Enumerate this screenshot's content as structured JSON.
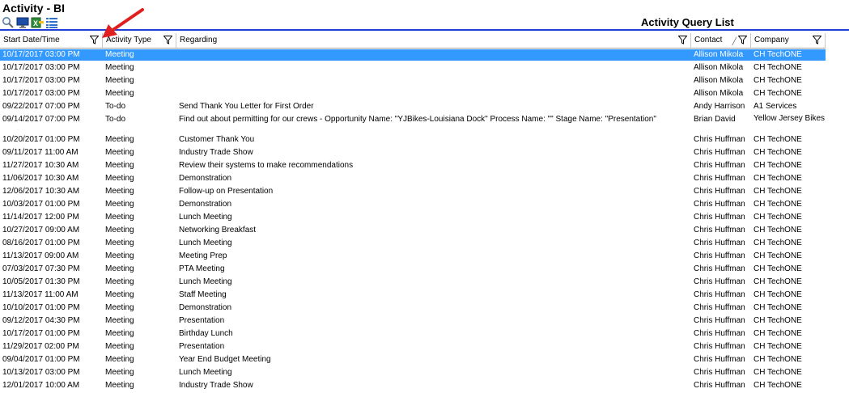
{
  "app": {
    "title": "Activity - BI"
  },
  "toolbar": {
    "icons": [
      "search-icon",
      "monitor-icon",
      "export-excel-icon",
      "list-icon"
    ]
  },
  "list_title": "Activity Query List",
  "columns": [
    {
      "label": "Start Date/Time",
      "filter": true
    },
    {
      "label": "Activity Type",
      "filter": true
    },
    {
      "label": "Regarding",
      "filter": true
    },
    {
      "label": "Contact",
      "filter": true,
      "sorted": true
    },
    {
      "label": "Company",
      "filter": true
    }
  ],
  "rows": [
    {
      "date": "10/17/2017 03:00 PM",
      "type": "Meeting",
      "regarding": "",
      "contact": "Allison Mikola",
      "company": "CH TechONE",
      "selected": true
    },
    {
      "date": "10/17/2017 03:00 PM",
      "type": "Meeting",
      "regarding": "",
      "contact": "Allison Mikola",
      "company": "CH TechONE"
    },
    {
      "date": "10/17/2017 03:00 PM",
      "type": "Meeting",
      "regarding": "",
      "contact": "Allison Mikola",
      "company": "CH TechONE"
    },
    {
      "date": "10/17/2017 03:00 PM",
      "type": "Meeting",
      "regarding": "",
      "contact": "Allison Mikola",
      "company": "CH TechONE"
    },
    {
      "date": "09/22/2017 07:00 PM",
      "type": "To-do",
      "regarding": "Send Thank You Letter for First Order",
      "contact": "Andy Harrison",
      "company": "A1 Services"
    },
    {
      "date": "09/14/2017 07:00 PM",
      "type": "To-do",
      "regarding": "Find out about permitting for our crews - Opportunity Name: \"YJBikes-Louisiana Dock\" Process Name: \"\" Stage Name: \"Presentation\"",
      "contact": "Brian David",
      "company": "Yellow Jersey Bikes",
      "tall": true
    },
    {
      "date": "10/20/2017 01:00 PM",
      "type": "Meeting",
      "regarding": "Customer Thank You",
      "contact": "Chris Huffman",
      "company": "CH TechONE"
    },
    {
      "date": "09/11/2017 11:00 AM",
      "type": "Meeting",
      "regarding": "Industry Trade Show",
      "contact": "Chris Huffman",
      "company": "CH TechONE"
    },
    {
      "date": "11/27/2017 10:30 AM",
      "type": "Meeting",
      "regarding": "Review their systems to make recommendations",
      "contact": "Chris Huffman",
      "company": "CH TechONE"
    },
    {
      "date": "11/06/2017 10:30 AM",
      "type": "Meeting",
      "regarding": "Demonstration",
      "contact": "Chris Huffman",
      "company": "CH TechONE"
    },
    {
      "date": "12/06/2017 10:30 AM",
      "type": "Meeting",
      "regarding": "Follow-up on Presentation",
      "contact": "Chris Huffman",
      "company": "CH TechONE"
    },
    {
      "date": "10/03/2017 01:00 PM",
      "type": "Meeting",
      "regarding": "Demonstration",
      "contact": "Chris Huffman",
      "company": "CH TechONE"
    },
    {
      "date": "11/14/2017 12:00 PM",
      "type": "Meeting",
      "regarding": "Lunch Meeting",
      "contact": "Chris Huffman",
      "company": "CH TechONE"
    },
    {
      "date": "10/27/2017 09:00 AM",
      "type": "Meeting",
      "regarding": "Networking Breakfast",
      "contact": "Chris Huffman",
      "company": "CH TechONE"
    },
    {
      "date": "08/16/2017 01:00 PM",
      "type": "Meeting",
      "regarding": "Lunch Meeting",
      "contact": "Chris Huffman",
      "company": "CH TechONE"
    },
    {
      "date": "11/13/2017 09:00 AM",
      "type": "Meeting",
      "regarding": "Meeting Prep",
      "contact": "Chris Huffman",
      "company": "CH TechONE"
    },
    {
      "date": "07/03/2017 07:30 PM",
      "type": "Meeting",
      "regarding": "PTA Meeting",
      "contact": "Chris Huffman",
      "company": "CH TechONE"
    },
    {
      "date": "10/05/2017 01:30 PM",
      "type": "Meeting",
      "regarding": "Lunch Meeting",
      "contact": "Chris Huffman",
      "company": "CH TechONE"
    },
    {
      "date": "11/13/2017 11:00 AM",
      "type": "Meeting",
      "regarding": "Staff Meeting",
      "contact": "Chris Huffman",
      "company": "CH TechONE"
    },
    {
      "date": "10/10/2017 01:00 PM",
      "type": "Meeting",
      "regarding": "Demonstration",
      "contact": "Chris Huffman",
      "company": "CH TechONE"
    },
    {
      "date": "09/12/2017 04:30 PM",
      "type": "Meeting",
      "regarding": "Presentation",
      "contact": "Chris Huffman",
      "company": "CH TechONE"
    },
    {
      "date": "10/17/2017 01:00 PM",
      "type": "Meeting",
      "regarding": "Birthday Lunch",
      "contact": "Chris Huffman",
      "company": "CH TechONE"
    },
    {
      "date": "11/29/2017 02:00 PM",
      "type": "Meeting",
      "regarding": "Presentation",
      "contact": "Chris Huffman",
      "company": "CH TechONE"
    },
    {
      "date": "09/04/2017 01:00 PM",
      "type": "Meeting",
      "regarding": "Year End Budget Meeting",
      "contact": "Chris Huffman",
      "company": "CH TechONE"
    },
    {
      "date": "10/13/2017 03:00 PM",
      "type": "Meeting",
      "regarding": "Lunch Meeting",
      "contact": "Chris Huffman",
      "company": "CH TechONE"
    },
    {
      "date": "12/01/2017 10:00 AM",
      "type": "Meeting",
      "regarding": "Industry Trade Show",
      "contact": "Chris Huffman",
      "company": "CH TechONE"
    }
  ],
  "colors": {
    "selection": "#3399ff",
    "rule": "#1f3fd6",
    "arrow": "#e02020"
  }
}
